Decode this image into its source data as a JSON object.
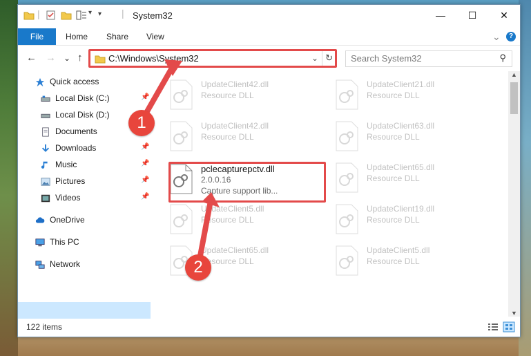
{
  "window": {
    "title": "System32",
    "qa_dropdown": "▾",
    "minimize": "—",
    "maximize": "☐",
    "close": "✕"
  },
  "ribbon": {
    "file": "File",
    "home": "Home",
    "share": "Share",
    "view": "View",
    "expand": "⌄",
    "help": "?"
  },
  "address": {
    "back": "←",
    "forward": "→",
    "recent": "⌄",
    "up": "↑",
    "path": "C:\\Windows\\System32",
    "dropdown": "⌄",
    "refresh": "↻"
  },
  "search": {
    "placeholder": "Search System32",
    "icon": "⚲"
  },
  "sidebar": {
    "quick_access": "Quick access",
    "items": [
      {
        "label": "Local Disk (C:)",
        "pinned": true
      },
      {
        "label": "Local Disk (D:)",
        "pinned": false
      },
      {
        "label": "Documents",
        "pinned": true
      },
      {
        "label": "Downloads",
        "pinned": true
      },
      {
        "label": "Music",
        "pinned": true
      },
      {
        "label": "Pictures",
        "pinned": true
      },
      {
        "label": "Videos",
        "pinned": true
      }
    ],
    "onedrive": "OneDrive",
    "this_pc": "This PC",
    "network": "Network"
  },
  "files": {
    "left": [
      {
        "name": "UpdateClient42.dll",
        "type": "Resource DLL"
      },
      {
        "name": "UpdateClient42.dll",
        "type": "Resource DLL"
      },
      {
        "name": "UpdateClient5.dll",
        "type": "Resource DLL"
      },
      {
        "name": "UpdateClient65.dll",
        "type": "Resource DLL"
      }
    ],
    "right": [
      {
        "name": "UpdateClient21.dll",
        "type": "Resource DLL"
      },
      {
        "name": "UpdateClient63.dll",
        "type": "Resource DLL"
      },
      {
        "name": "UpdateClient65.dll",
        "type": "Resource DLL"
      },
      {
        "name": "UpdateClient19.dll",
        "type": "Resource DLL"
      },
      {
        "name": "UpdateClient5.dll",
        "type": "Resource DLL"
      }
    ],
    "highlighted": {
      "name": "pclecapturepctv.dll",
      "version": "2.0.0.16",
      "description": "Capture support lib..."
    }
  },
  "status": {
    "count": "122 items"
  },
  "annotations": {
    "step1": "1",
    "step2": "2"
  },
  "colors": {
    "accent": "#1979ca",
    "highlight_box": "#e34a4a",
    "selection": "#cce8ff"
  }
}
